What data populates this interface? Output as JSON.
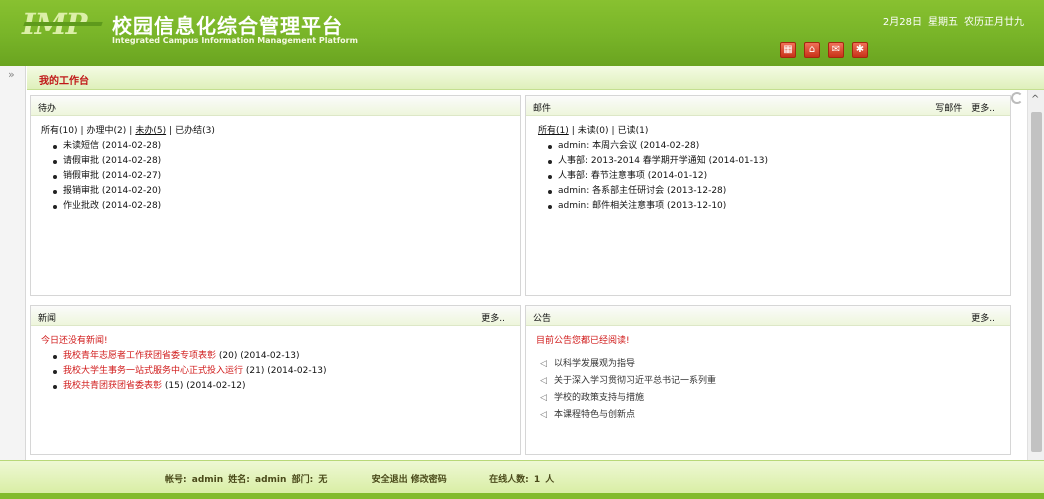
{
  "header": {
    "logo_text": "IMP",
    "title_cn": "校园信息化综合管理平台",
    "title_en": "Integrated Campus Information Management Platform",
    "date": "2月28日",
    "weekday": "星期五",
    "lunar": "农历正月廿九",
    "icons": [
      "grid-icon",
      "home-icon",
      "mail-icon",
      "settings-icon"
    ]
  },
  "rail": {
    "toggle": "»"
  },
  "workbench": {
    "title": "我的工作台"
  },
  "todo": {
    "title": "待办",
    "filters": {
      "all": "所有(10)",
      "processing": "办理中(2)",
      "pending": "未办(5)",
      "done": "已办结(3)"
    },
    "items": [
      "未读短信 (2014-02-28)",
      "请假审批 (2014-02-28)",
      "销假审批 (2014-02-27)",
      "报销审批 (2014-02-20)",
      "作业批改 (2014-02-28)"
    ]
  },
  "mail": {
    "title": "邮件",
    "compose": "写邮件",
    "more": "更多..",
    "filters": {
      "all": "所有(1)",
      "unread": "未读(0)",
      "read": "已读(1)"
    },
    "items": [
      "admin: 本周六会议 (2014-02-28)",
      "人事部: 2013-2014 春学期开学通知 (2014-01-13)",
      "人事部: 春节注意事项 (2014-01-12)",
      "admin: 各系部主任研讨会 (2013-12-28)",
      "admin: 邮件相关注意事项 (2013-12-10)"
    ]
  },
  "news": {
    "title": "新闻",
    "more": "更多..",
    "notice": "今日还没有新闻!",
    "items": [
      {
        "title": "我校青年志愿者工作获团省委专项表彰",
        "meta": " (20) (2014-02-13)"
      },
      {
        "title": "我校大学生事务一站式服务中心正式投入运行",
        "meta": " (21) (2014-02-13)"
      },
      {
        "title": "我校共青团获团省委表彰",
        "meta": " (15) (2014-02-12)"
      }
    ]
  },
  "announcements": {
    "title": "公告",
    "more": "更多..",
    "notice": "目前公告您都已经阅读!",
    "items": [
      "以科学发展观为指导",
      "关于深入学习贯彻习近平总书记一系列重",
      "学校的政策支持与措施",
      "本课程特色与创新点"
    ]
  },
  "footer": {
    "account_label": "帐号:",
    "account": "admin",
    "name_label": "姓名:",
    "name": "admin",
    "dept_label": "部门:",
    "dept": "无",
    "logout": "安全退出",
    "change_password": "修改密码",
    "online_label": "在线人数:",
    "online_count": "1",
    "online_unit": "人"
  }
}
